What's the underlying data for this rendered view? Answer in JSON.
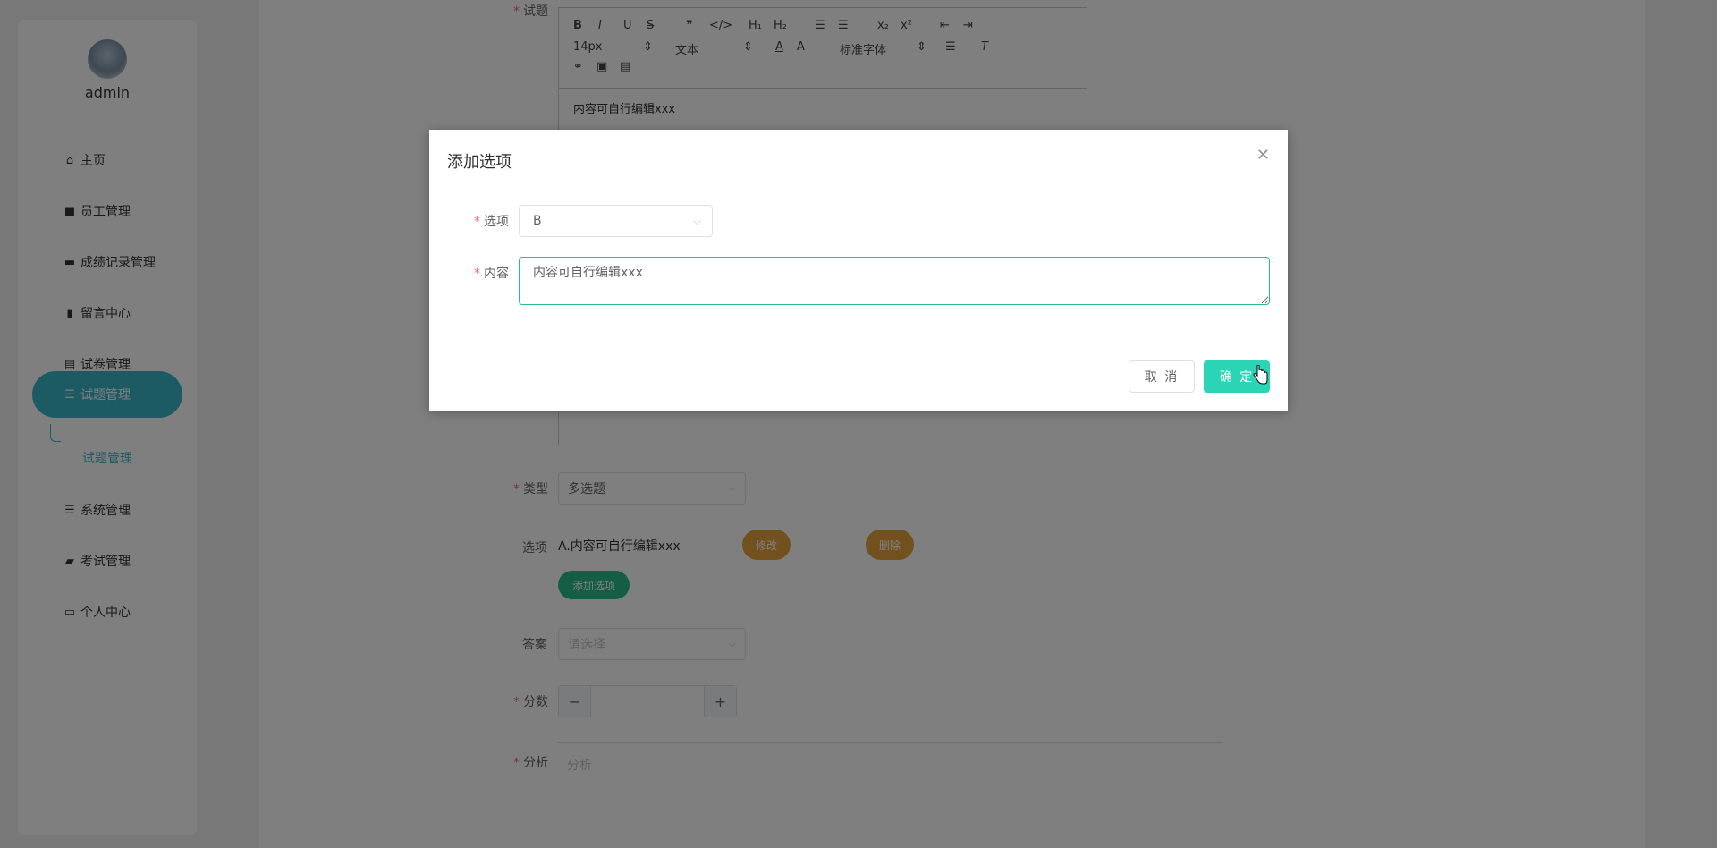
{
  "sidebar": {
    "username": "admin",
    "items": [
      {
        "label": "主页",
        "icon": "home-icon"
      },
      {
        "label": "员工管理",
        "icon": "user-icon"
      },
      {
        "label": "成绩记录管理",
        "icon": "monitor-icon"
      },
      {
        "label": "留言中心",
        "icon": "chart-icon"
      },
      {
        "label": "试卷管理",
        "icon": "book-icon"
      },
      {
        "label": "试题管理",
        "icon": "list-icon"
      },
      {
        "label": "系统管理",
        "icon": "list-icon"
      },
      {
        "label": "考试管理",
        "icon": "briefcase-icon"
      },
      {
        "label": "个人中心",
        "icon": "card-icon"
      }
    ],
    "sub_item": "试题管理"
  },
  "form": {
    "question_label": "试题",
    "editor": {
      "font_size": "14px",
      "text_type": "文本",
      "font_family": "标准字体",
      "content": "内容可自行编辑xxx"
    },
    "type_label": "类型",
    "type_value": "多选题",
    "options_label": "选项",
    "option_a": "A.内容可自行编辑xxx",
    "edit_btn": "修改",
    "delete_btn": "删除",
    "add_option_btn": "添加选项",
    "answer_label": "答案",
    "answer_placeholder": "请选择",
    "score_label": "分数",
    "analysis_label": "分析",
    "analysis_placeholder": "分析"
  },
  "dialog": {
    "title": "添加选项",
    "option_label": "选项",
    "option_value": "B",
    "content_label": "内容",
    "content_value": "内容可自行编辑xxx",
    "cancel": "取 消",
    "confirm": "确 定"
  },
  "colors": {
    "accent": "#3ab6c8",
    "confirm": "#2bd4b4",
    "required": "#f56c6c",
    "edit": "#e6a23c"
  }
}
